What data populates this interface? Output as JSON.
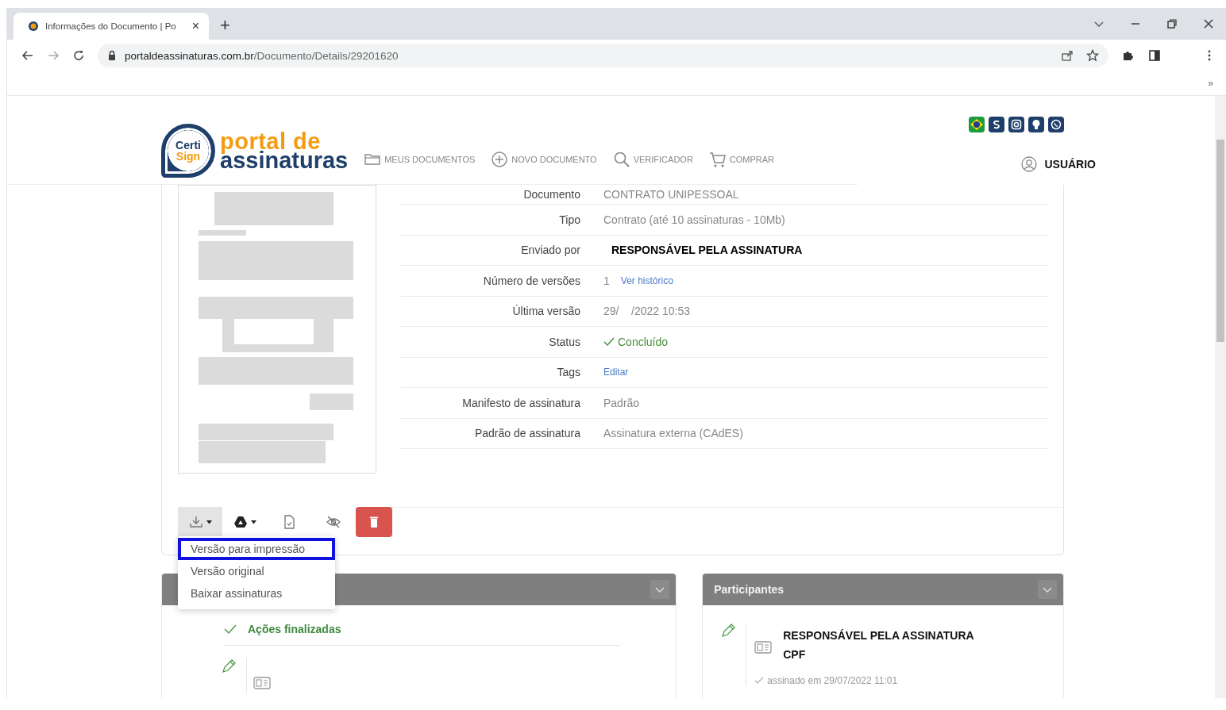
{
  "browser": {
    "tab": {
      "title": "Informações do Documento | Po",
      "close": "×"
    },
    "new_tab": "+",
    "url": {
      "domain": "portaldeassinaturas.com.br",
      "path": "/Documento/Details/29201620"
    },
    "bookmarks_more": "»"
  },
  "header": {
    "logo": {
      "badge_top": "Certi",
      "badge_bottom": "Sign",
      "line1": "portal de",
      "line2": "assinaturas"
    },
    "nav": [
      {
        "label": "MEUS DOCUMENTOS",
        "kind": "folder"
      },
      {
        "label": "NOVO DOCUMENTO",
        "kind": "plus"
      },
      {
        "label": "VERIFICADOR",
        "kind": "search"
      },
      {
        "label": "COMPRAR",
        "kind": "cart"
      }
    ],
    "user": "USUÁRIO"
  },
  "details": [
    {
      "label": "Documento",
      "value": "CONTRATO UNIPESSOAL",
      "kind": "text"
    },
    {
      "label": "Tipo",
      "value": "Contrato (até 10 assinaturas - 10Mb)",
      "kind": "text"
    },
    {
      "label": "Enviado por",
      "value": "RESPONSÁVEL PELA ASSINATURA",
      "kind": "person"
    },
    {
      "label": "Número de versões",
      "value": "1",
      "link": "Ver histórico",
      "kind": "versions"
    },
    {
      "label": "Última versão",
      "value": "29/    /2022 10:53",
      "kind": "text"
    },
    {
      "label": "Status",
      "value": "Concluído",
      "kind": "status"
    },
    {
      "label": "Tags",
      "value": "Editar",
      "kind": "link"
    },
    {
      "label": "Manifesto de assinatura",
      "value": "Padrão",
      "kind": "text"
    },
    {
      "label": "Padrão de assinatura",
      "value": "Assinatura externa (CAdES)",
      "kind": "text"
    }
  ],
  "toolbar": [
    {
      "kind": "download",
      "caret": true,
      "active": true
    },
    {
      "kind": "drive",
      "caret": true,
      "active": false
    },
    {
      "kind": "file",
      "caret": false,
      "active": false
    },
    {
      "kind": "hide",
      "caret": false,
      "active": false
    },
    {
      "kind": "delete",
      "caret": false,
      "active": false
    }
  ],
  "dropdown": [
    {
      "label": "Versão para impressão",
      "selected": true
    },
    {
      "label": "Versão original",
      "selected": false
    },
    {
      "label": "Baixar assinaturas",
      "selected": false
    }
  ],
  "actions_panel": {
    "status": "Ações finalizadas"
  },
  "participants_panel": {
    "title": "Participantes",
    "participants": [
      {
        "name": "RESPONSÁVEL PELA ASSINATURA",
        "document": "CPF",
        "signed": "assinado em 29/07/2022 11:01"
      }
    ]
  }
}
